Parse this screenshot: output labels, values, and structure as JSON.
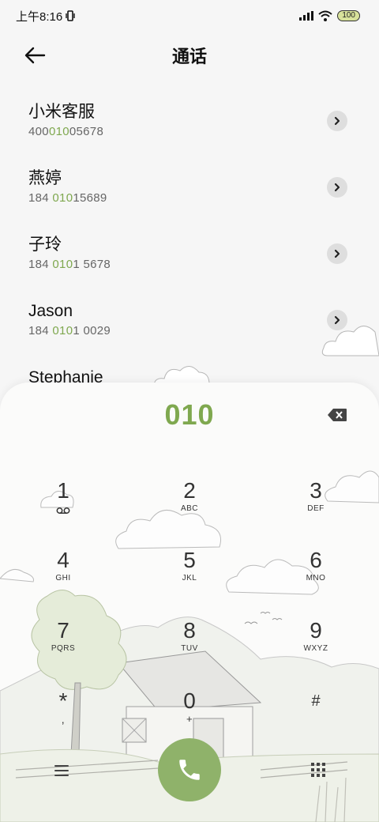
{
  "status_bar": {
    "time": "上午8:16",
    "battery": "100"
  },
  "header": {
    "title": "通话"
  },
  "contacts": [
    {
      "name": "小米客服",
      "number_pre": "400",
      "number_match": "010",
      "number_post": "05678"
    },
    {
      "name": "燕婷",
      "number_pre": "184 ",
      "number_match": "010",
      "number_post": "15689"
    },
    {
      "name": "子玲",
      "number_pre": "184 ",
      "number_match": "010",
      "number_post": "1 5678"
    },
    {
      "name": "Jason",
      "number_pre": "184 ",
      "number_match": "010",
      "number_post": "1 0029"
    },
    {
      "name": "Stephanie",
      "number_pre": "",
      "number_match": "",
      "number_post": ""
    }
  ],
  "dialer": {
    "dialed_number": "010",
    "keys": [
      {
        "digit": "1",
        "letters": ""
      },
      {
        "digit": "2",
        "letters": "ABC"
      },
      {
        "digit": "3",
        "letters": "DEF"
      },
      {
        "digit": "4",
        "letters": "GHI"
      },
      {
        "digit": "5",
        "letters": "JKL"
      },
      {
        "digit": "6",
        "letters": "MNO"
      },
      {
        "digit": "7",
        "letters": "PQRS"
      },
      {
        "digit": "8",
        "letters": "TUV"
      },
      {
        "digit": "9",
        "letters": "WXYZ"
      },
      {
        "digit": "*",
        "letters": ","
      },
      {
        "digit": "0",
        "letters": "+"
      },
      {
        "digit": "#",
        "letters": ""
      }
    ]
  },
  "icons": {
    "back": "arrow-left-icon",
    "chevron": "chevron-right-icon",
    "backspace": "backspace-icon",
    "voicemail": "voicemail-icon",
    "call": "phone-icon",
    "menu": "menu-icon",
    "keypad": "keypad-icon"
  },
  "colors": {
    "accent": "#7fa84f",
    "call_button": "#8fb26a",
    "background": "#f6f6f6"
  }
}
